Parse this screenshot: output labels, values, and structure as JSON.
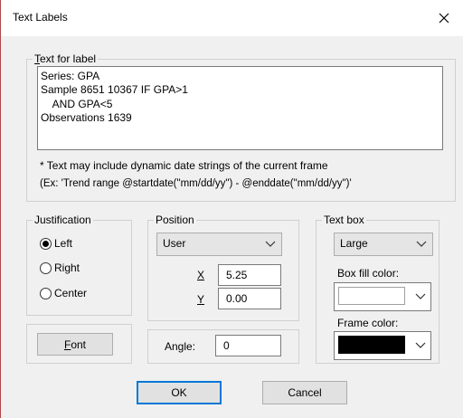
{
  "window": {
    "title": "Text Labels"
  },
  "text_for_label": {
    "legend_prefix": "",
    "legend_underlined": "T",
    "legend_rest": "ext for label",
    "lines": [
      "Series: GPA",
      "Sample 8651 10367 IF GPA>1",
      "    AND GPA<5",
      "Observations 1639"
    ]
  },
  "notes": {
    "line1": "* Text may include dynamic date strings of the current frame",
    "line2": "(Ex: 'Trend range @startdate(\"mm/dd/yy\") - @enddate(\"mm/dd/yy\")'"
  },
  "justification": {
    "legend": "Justification",
    "options": [
      {
        "label": "Left",
        "selected": true
      },
      {
        "label": "Right",
        "selected": false
      },
      {
        "label": "Center",
        "selected": false
      }
    ]
  },
  "position": {
    "legend": "Position",
    "mode": "User",
    "x_label": "X",
    "x_value": "5.25",
    "y_label": "Y",
    "y_value": "0.00"
  },
  "text_box": {
    "legend": "Text box",
    "size": "Large",
    "fill_label": "Box fill color:",
    "fill_color": "#ffffff",
    "frame_label": "Frame color:",
    "frame_color": "#000000"
  },
  "angle": {
    "label": "Angle:",
    "value": "0"
  },
  "buttons": {
    "font_u": "F",
    "font_rest": "ont",
    "ok": "OK",
    "cancel": "Cancel"
  },
  "icons": {
    "close": "close-icon",
    "dropdown": "chevron-down-icon"
  }
}
